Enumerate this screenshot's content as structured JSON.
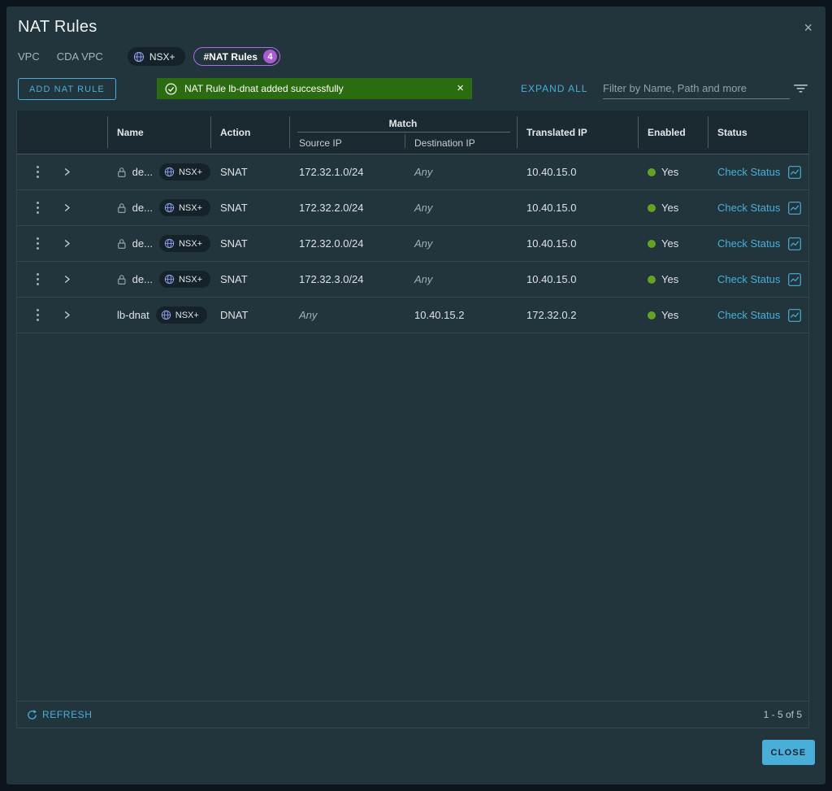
{
  "dialog": {
    "title": "NAT Rules",
    "close_glyph": "×",
    "breadcrumb": {
      "items": [
        "VPC",
        "CDA VPC"
      ],
      "nsx_tag": "NSX+",
      "count_pill": {
        "label": "#NAT Rules",
        "count": "4"
      }
    },
    "toolbar": {
      "add_button": "ADD NAT RULE",
      "banner": {
        "message": "NAT Rule lb-dnat added successfully",
        "close_glyph": "×"
      },
      "expand_all": "EXPAND ALL",
      "filter_placeholder": "Filter by Name, Path and more"
    }
  },
  "table": {
    "columns": {
      "name": "Name",
      "action": "Action",
      "match": "Match",
      "source_ip": "Source IP",
      "destination_ip": "Destination IP",
      "translated_ip": "Translated IP",
      "enabled": "Enabled",
      "status": "Status"
    },
    "rows": [
      {
        "name": "de...",
        "tag": "NSX+",
        "action": "SNAT",
        "source_ip": "172.32.1.0/24",
        "destination_ip": "Any",
        "translated_ip": "10.40.15.0",
        "enabled": "Yes",
        "status": "Check Status"
      },
      {
        "name": "de...",
        "tag": "NSX+",
        "action": "SNAT",
        "source_ip": "172.32.2.0/24",
        "destination_ip": "Any",
        "translated_ip": "10.40.15.0",
        "enabled": "Yes",
        "status": "Check Status"
      },
      {
        "name": "de...",
        "tag": "NSX+",
        "action": "SNAT",
        "source_ip": "172.32.0.0/24",
        "destination_ip": "Any",
        "translated_ip": "10.40.15.0",
        "enabled": "Yes",
        "status": "Check Status"
      },
      {
        "name": "de...",
        "tag": "NSX+",
        "action": "SNAT",
        "source_ip": "172.32.3.0/24",
        "destination_ip": "Any",
        "translated_ip": "10.40.15.0",
        "enabled": "Yes",
        "status": "Check Status"
      },
      {
        "name": "lb-dnat",
        "tag": "NSX+",
        "action": "DNAT",
        "source_ip": "Any",
        "destination_ip": "10.40.15.2",
        "translated_ip": "172.32.0.2",
        "enabled": "Yes",
        "status": "Check Status"
      }
    ]
  },
  "footer": {
    "refresh_label": "REFRESH",
    "range": "1 - 5 of 5"
  },
  "close_button": "CLOSE",
  "colors": {
    "accent": "#49afd9",
    "success_banner": "#2c6c10",
    "enabled_dot": "#62a420",
    "purple_pill": "#b36ae2",
    "modal_bg": "#22343c"
  }
}
